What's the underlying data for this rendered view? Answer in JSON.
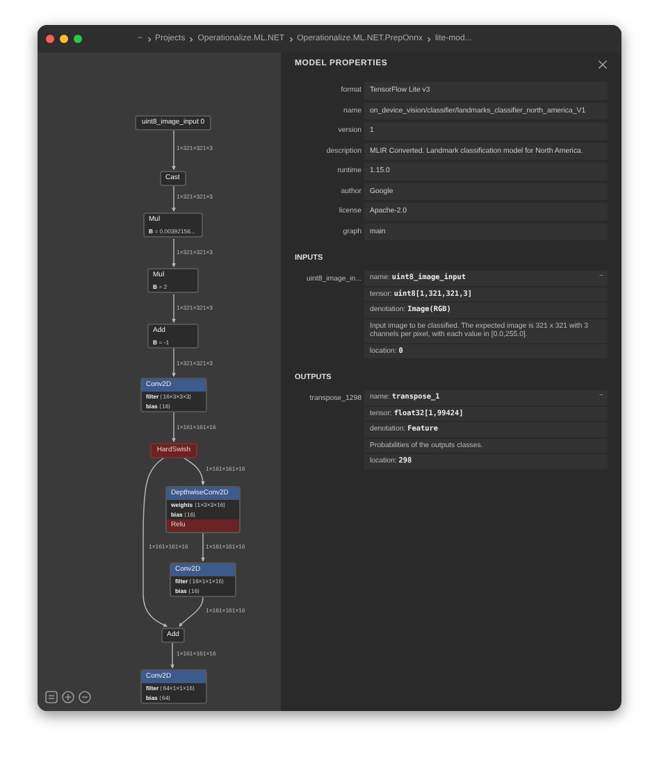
{
  "window": {
    "breadcrumb": [
      "~",
      "Projects",
      "Operationalize.ML.NET",
      "Operationalize.ML.NET.PrepOnnx",
      "lite-mod..."
    ]
  },
  "graph": {
    "nodes": [
      {
        "kind": "input",
        "title": "uint8_image_input 0"
      },
      {
        "kind": "plain",
        "title": "Cast"
      },
      {
        "kind": "plain",
        "title": "Mul",
        "attributes": [
          {
            "name": "B",
            "value": "= 0.00392156..."
          }
        ]
      },
      {
        "kind": "plain",
        "title": "Mul",
        "attributes": [
          {
            "name": "B",
            "value": "= 2"
          }
        ]
      },
      {
        "kind": "plain",
        "title": "Add",
        "attributes": [
          {
            "name": "B",
            "value": "= -1"
          }
        ]
      },
      {
        "kind": "layer",
        "title": "Conv2D",
        "attributes": [
          {
            "name": "filter",
            "value": "⟨16×3×3×3⟩"
          },
          {
            "name": "bias",
            "value": "⟨16⟩"
          }
        ]
      },
      {
        "kind": "activation",
        "title": "HardSwish"
      },
      {
        "kind": "layer",
        "title": "DepthwiseConv2D",
        "attributes": [
          {
            "name": "weights",
            "value": "⟨1×3×3×16⟩"
          },
          {
            "name": "bias",
            "value": "⟨16⟩"
          }
        ],
        "activation": "Relu"
      },
      {
        "kind": "layer",
        "title": "Conv2D",
        "attributes": [
          {
            "name": "filter",
            "value": "⟨16×1×1×16⟩"
          },
          {
            "name": "bias",
            "value": "⟨16⟩"
          }
        ]
      },
      {
        "kind": "plain",
        "title": "Add"
      },
      {
        "kind": "layer",
        "title": "Conv2D",
        "attributes": [
          {
            "name": "filter",
            "value": "⟨64×1×1×16⟩"
          },
          {
            "name": "bias",
            "value": "⟨64⟩"
          }
        ]
      }
    ],
    "edges": [
      {
        "label": "1×321×321×3"
      },
      {
        "label": "1×321×321×3"
      },
      {
        "label": "1×321×321×3"
      },
      {
        "label": "1×321×321×3"
      },
      {
        "label": "1×321×321×3"
      },
      {
        "label": "1×161×161×16"
      },
      {
        "label": "1×161×161×16"
      },
      {
        "label": "1×161×161×16"
      },
      {
        "label": "1×161×161×16"
      },
      {
        "label": "1×161×161×16"
      },
      {
        "label": "1×161×161×16"
      }
    ]
  },
  "sidebar": {
    "title": "MODEL PROPERTIES",
    "properties": [
      {
        "label": "format",
        "value": "TensorFlow Lite v3"
      },
      {
        "label": "name",
        "value": "on_device_vision/classifier/landmarks_classifier_north_america_V1"
      },
      {
        "label": "version",
        "value": "1"
      },
      {
        "label": "description",
        "value": "MLIR Converted. Landmark classification model for North America."
      },
      {
        "label": "runtime",
        "value": "1.15.0"
      },
      {
        "label": "author",
        "value": "Google"
      },
      {
        "label": "license",
        "value": "Apache-2.0"
      },
      {
        "label": "graph",
        "value": "main"
      }
    ],
    "sections": [
      {
        "title": "INPUTS",
        "items": [
          {
            "label": "uint8_image_in...",
            "toggle": "−",
            "fields": [
              {
                "key": "name:",
                "value": "uint8_image_input"
              },
              {
                "key": "tensor:",
                "value": "uint8[1,321,321,3]"
              },
              {
                "key": "denotation:",
                "value": "Image(RGB)"
              },
              {
                "text": "Input image to be classified. The expected image is 321 x 321 with 3 channels per pixel, with each value in [0.0,255.0]."
              },
              {
                "key": "location:",
                "value": "0"
              }
            ]
          }
        ]
      },
      {
        "title": "OUTPUTS",
        "items": [
          {
            "label": "transpose_1298",
            "toggle": "−",
            "fields": [
              {
                "key": "name:",
                "value": "transpose_1"
              },
              {
                "key": "tensor:",
                "value": "float32[1,99424]"
              },
              {
                "key": "denotation:",
                "value": "Feature"
              },
              {
                "text": "Probabilities of the outputs classes."
              },
              {
                "key": "location:",
                "value": "298"
              }
            ]
          }
        ]
      }
    ]
  }
}
